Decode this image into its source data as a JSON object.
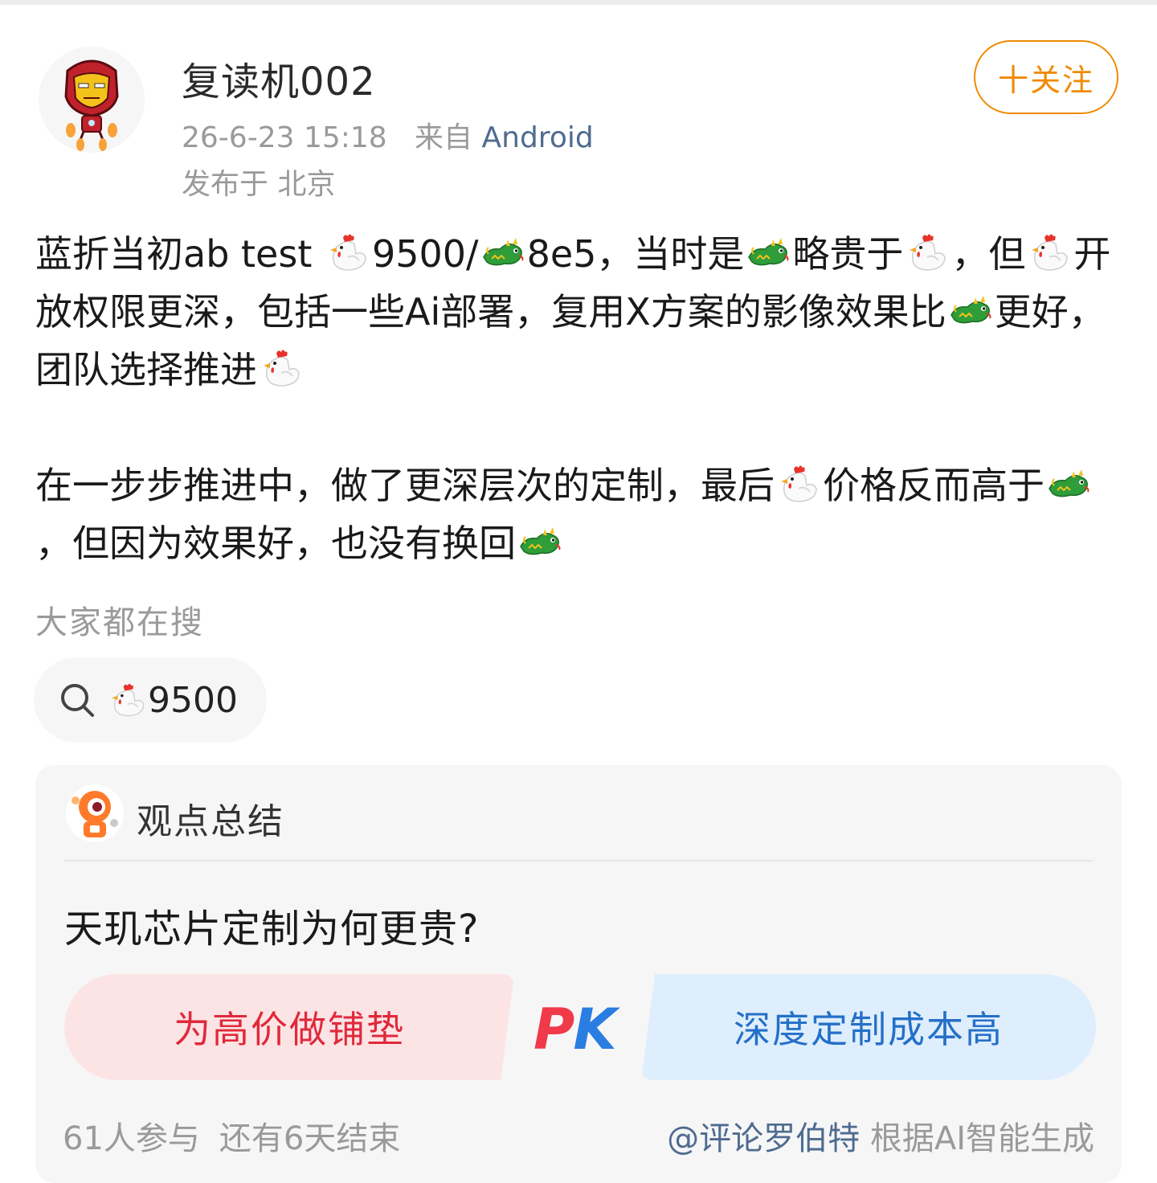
{
  "header": {
    "username": "复读机002",
    "timestamp": "26-6-23 15:18",
    "source_prefix": "来自",
    "source": "Android",
    "location": "发布于 北京",
    "follow_label": "十关注"
  },
  "post": {
    "paragraph1": [
      {
        "t": "text",
        "v": "蓝折当初ab test "
      },
      {
        "t": "emoji",
        "v": "chicken-emoji"
      },
      {
        "t": "text",
        "v": "9500/"
      },
      {
        "t": "emoji",
        "v": "dragon-emoji"
      },
      {
        "t": "text",
        "v": "8e5，当时是"
      },
      {
        "t": "emoji",
        "v": "dragon-emoji"
      },
      {
        "t": "text",
        "v": "略贵于"
      },
      {
        "t": "emoji",
        "v": "chicken-emoji"
      },
      {
        "t": "text",
        "v": "，但"
      },
      {
        "t": "emoji",
        "v": "chicken-emoji"
      },
      {
        "t": "text",
        "v": "开放权限更深，包括一些Ai部署，复用X方案的影像效果比"
      },
      {
        "t": "emoji",
        "v": "dragon-emoji"
      },
      {
        "t": "text",
        "v": "更好，团队选择推进"
      },
      {
        "t": "emoji",
        "v": "chicken-emoji"
      }
    ],
    "paragraph2": [
      {
        "t": "text",
        "v": "在一步步推进中，做了更深层次的定制，最后"
      },
      {
        "t": "emoji",
        "v": "chicken-emoji"
      },
      {
        "t": "text",
        "v": "价格反而高于"
      },
      {
        "t": "emoji",
        "v": "dragon-emoji"
      },
      {
        "t": "text",
        "v": "，但因为效果好，也没有换回"
      },
      {
        "t": "emoji",
        "v": "dragon-emoji"
      }
    ]
  },
  "search": {
    "label": "大家都在搜",
    "keyword": "9500",
    "icon": "search-icon"
  },
  "opinion_card": {
    "title": "观点总结",
    "question": "天玑芯片定制为何更贵?",
    "left_option": "为高价做铺垫",
    "right_option": "深度定制成本高",
    "pk_p": "P",
    "pk_k": "K",
    "participants": "61人参与",
    "remaining": "还有6天结束",
    "ai_mention": "@评论罗伯特",
    "ai_note": " 根据AI智能生成"
  },
  "colors": {
    "accent_orange": "#f08a00",
    "link_blue": "#4f6b8f",
    "pk_red": "#e0293b",
    "pk_blue": "#2470c8"
  }
}
